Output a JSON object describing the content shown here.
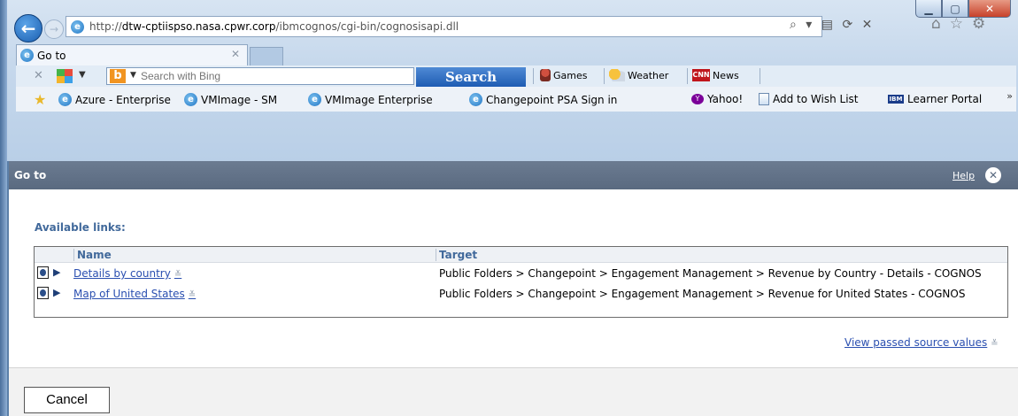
{
  "browser": {
    "address_url_prefix": "http://",
    "address_url_domain": "dtw-cptiispso.nasa.cpwr.corp",
    "address_url_path": "/ibmcognos/cgi-bin/cognosisapi.dll",
    "address_tools": "⌕ ▾ ▤ ⟳ ✕",
    "tab_title": "Go to"
  },
  "toolbar": {
    "search_placeholder": "Search with Bing",
    "search_button": "Search",
    "games": "Games",
    "weather": "Weather",
    "news": "News",
    "cnn_logo": "CNN"
  },
  "favorites": [
    {
      "label": "Azure - Enterprise",
      "icon": "ie-icon"
    },
    {
      "label": "VMImage - SM",
      "icon": "ie-icon"
    },
    {
      "label": "VMImage Enterprise",
      "icon": "ie-icon"
    },
    {
      "label": "Changepoint PSA Sign in",
      "icon": "ie-icon"
    },
    {
      "label": "Yahoo!",
      "icon": "yahoo-icon"
    },
    {
      "label": "Add to Wish List",
      "icon": "page-icon"
    },
    {
      "label": "Learner Portal",
      "icon": "ibm-icon",
      "logo_text": "IBM"
    }
  ],
  "dialog": {
    "title": "Go to",
    "help": "Help",
    "available_links": "Available links:",
    "columns": {
      "name": "Name",
      "target": "Target"
    },
    "rows": [
      {
        "name": "Details by country",
        "target": "Public Folders > Changepoint > Engagement Management > Revenue by Country - Details - COGNOS"
      },
      {
        "name": "Map of United States",
        "target": "Public Folders > Changepoint > Engagement Management > Revenue for United States - COGNOS"
      }
    ],
    "view_passed": "View passed source values",
    "cancel": "Cancel"
  },
  "colors": {
    "header_bar": "#5a6a80",
    "link": "#2a4fb0",
    "label_blue": "#41699b"
  }
}
